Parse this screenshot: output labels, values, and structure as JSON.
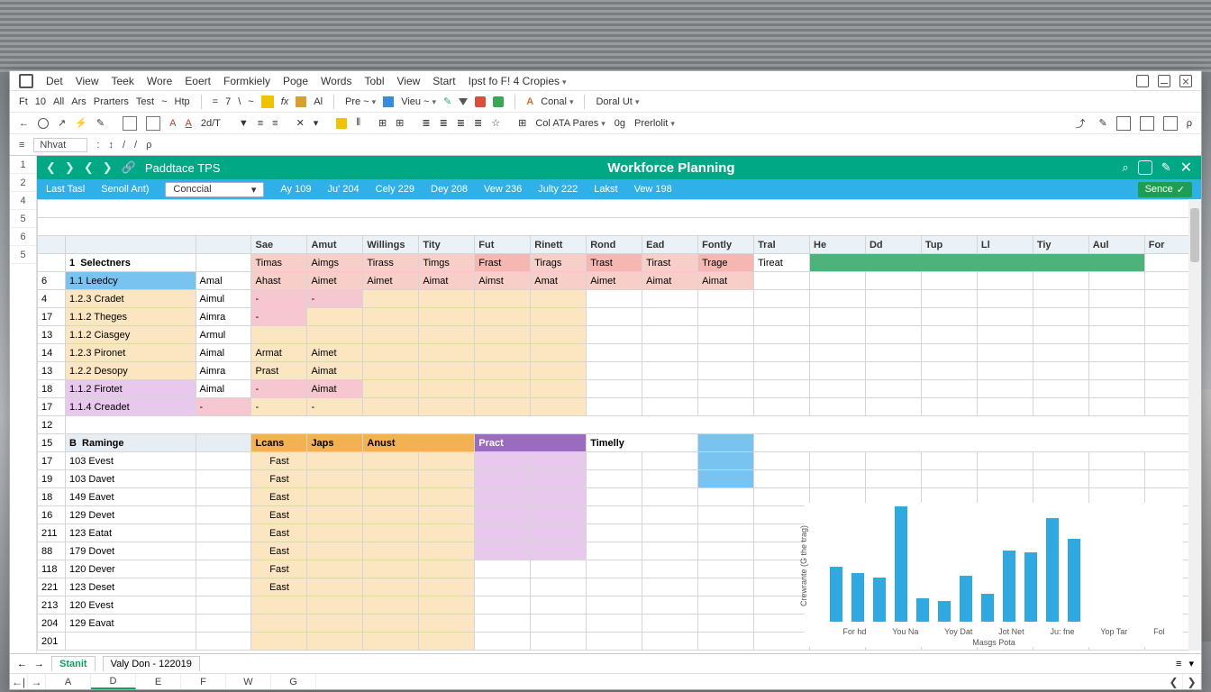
{
  "menu": {
    "items": [
      "Det",
      "View",
      "Teek",
      "Wore",
      "Eoert",
      "Formkiely",
      "Poge",
      "Words",
      "Tobl",
      "View",
      "Start",
      "Ipst fo F! 4 Cropies"
    ]
  },
  "ribbon1": {
    "left": [
      "Ft",
      "10",
      "All",
      "Ars",
      "Prarters",
      "Test",
      "~",
      "Htp"
    ],
    "mid1": [
      "=",
      "7",
      "\\",
      "~"
    ],
    "fx": "fx",
    "al": "Al",
    "mid2": [
      "Pre ~",
      "Vieu ~"
    ],
    "conal": "Conal",
    "right": [
      "Doral Ut"
    ]
  },
  "ribbon2": {
    "left_nav": [
      "←",
      "○",
      "↗",
      "⚡",
      "✎"
    ],
    "edit_group": "2d/T",
    "right_labels": [
      "Col ATA Pares",
      "0g",
      "Prerlolit"
    ]
  },
  "formula": {
    "name": "Nhvat",
    "buttons": [
      "↕",
      "/",
      "/",
      "ρ"
    ]
  },
  "teal": {
    "brand": "Paddtace TPS",
    "title": "Workforce Planning"
  },
  "bluebar": {
    "last": "Last Tasl",
    "scroll": "Senoll Ant)",
    "dropdown": "Conccial",
    "periods": [
      "Ay 109",
      "Ju' 204",
      "Cely 229",
      "Dey 208",
      "Vew 236",
      "Julty 222",
      "Lakst",
      "Vew 198"
    ],
    "save": "Sence"
  },
  "cols": [
    "Sae",
    "Amut",
    "Willings",
    "Tity",
    "Fut",
    "Rinett",
    "Rond",
    "Ead",
    "Fontly",
    "Tral",
    "He",
    "Dd",
    "Tup",
    "Ll",
    "Tiy",
    "Aul",
    "For"
  ],
  "row_sub": [
    "Timas",
    "Aimgs",
    "Tirass",
    "Timgs",
    "Frast",
    "Tirags",
    "Trast",
    "Tirast",
    "Trage",
    "Tireat"
  ],
  "sectionA": {
    "num": "1",
    "title": "Selectners"
  },
  "rowsA": [
    {
      "rn": "6",
      "code": "1.1",
      "name": "Leedcy",
      "c1": "Amal",
      "cells": [
        "Ahast",
        "Aimet",
        "Aimet",
        "Aimat",
        "Aimst",
        "Amat",
        "Aimet",
        "Aimat",
        "Aimat"
      ]
    },
    {
      "rn": "4",
      "code": "1.2.3",
      "name": "Cradet",
      "c1": "Aimul",
      "cells": [
        "-",
        "-",
        "",
        "",
        "",
        "",
        "",
        "",
        ""
      ]
    },
    {
      "rn": "17",
      "code": "1.1.2",
      "name": "Theges",
      "c1": "Aimra",
      "cells": [
        "-",
        "",
        "",
        "",
        "",
        "",
        "",
        "",
        ""
      ]
    },
    {
      "rn": "13",
      "code": "1.1.2",
      "name": "Ciasgey",
      "c1": "Armul",
      "cells": [
        "",
        "",
        "",
        "",
        "",
        "",
        "",
        "",
        ""
      ]
    },
    {
      "rn": "14",
      "code": "1.2.3",
      "name": "Pironet",
      "c1": "Aimal",
      "cells": [
        "Armat",
        "Aimet",
        "",
        "",
        "",
        "",
        "",
        "",
        ""
      ]
    },
    {
      "rn": "13",
      "code": "1.2.2",
      "name": "Desopy",
      "c1": "Aimra",
      "cells": [
        "Prast",
        "Aimat",
        "",
        "",
        "",
        "",
        "",
        "",
        ""
      ]
    },
    {
      "rn": "18",
      "code": "1.1.2",
      "name": "Firotet",
      "c1": "Aimal",
      "cells": [
        "-",
        "Aimat",
        "",
        "",
        "",
        "",
        "",
        "",
        ""
      ]
    },
    {
      "rn": "17",
      "code": "1.1.4",
      "name": "Creadet",
      "c1": "-",
      "cells": [
        "-",
        "-",
        "",
        "",
        "",
        "",
        "",
        "",
        ""
      ]
    }
  ],
  "sectionB": {
    "num": "B",
    "title": "Raminge",
    "hdrs": [
      "Lcans",
      "Japs",
      "Anust",
      "",
      "Pract",
      "",
      "Timelly"
    ]
  },
  "rowsB": [
    {
      "rn": "17",
      "code": "103",
      "name": "Evest",
      "c": "Fast"
    },
    {
      "rn": "19",
      "code": "103",
      "name": "Davet",
      "c": "Fast"
    },
    {
      "rn": "18",
      "code": "149",
      "name": "Eavet",
      "c": "East"
    },
    {
      "rn": "16",
      "code": "129",
      "name": "Devet",
      "c": "East"
    },
    {
      "rn": "211",
      "code": "123",
      "name": "Eatat",
      "c": "East"
    },
    {
      "rn": "88",
      "code": "179",
      "name": "Dovet",
      "c": "East"
    },
    {
      "rn": "118",
      "code": "120",
      "name": "Dever",
      "c": "Fast"
    },
    {
      "rn": "221",
      "code": "123",
      "name": "Deset",
      "c": "East"
    },
    {
      "rn": "213",
      "code": "120",
      "name": "Evest",
      "c": ""
    },
    {
      "rn": "204",
      "code": "129",
      "name": "Eavat",
      "c": ""
    },
    {
      "rn": "201",
      "code": "",
      "name": "",
      "c": ""
    }
  ],
  "chart_data": {
    "type": "bar",
    "categories": [
      "For hd",
      "You Na",
      "Yoy Dat",
      "Jot Net",
      "Ju: fne",
      "Yop Tar",
      "Fol"
    ],
    "values": [
      48,
      42,
      38,
      100,
      20,
      18,
      40,
      24,
      62,
      60,
      90,
      72
    ],
    "ylabel": "Crewrante (G the trag)",
    "xlabel": "Masgs Pota",
    "title": "",
    "ylim": [
      0,
      100
    ]
  },
  "tabs": {
    "active": "Stanit",
    "second": "Valy Don - 122019"
  },
  "col_letters": [
    "A",
    "D",
    "E",
    "F",
    "W",
    "G"
  ],
  "left_rownums_top": [
    "1",
    "2",
    "4",
    "5",
    "6",
    "5"
  ],
  "left_rownums_mid": [
    "12",
    "15"
  ]
}
